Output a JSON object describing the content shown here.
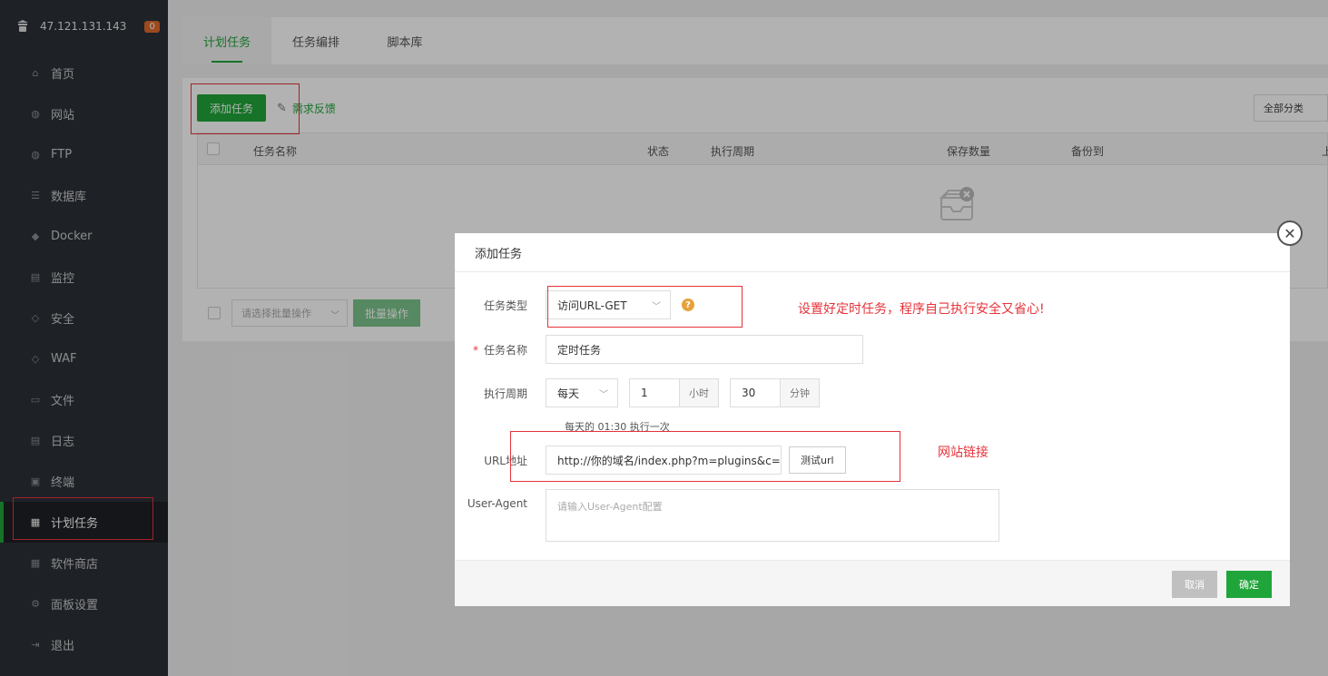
{
  "sidebar": {
    "server_ip": "47.121.131.143",
    "badge": "0",
    "items": [
      {
        "label": "首页",
        "icon": "home-icon",
        "glyph": "⌂"
      },
      {
        "label": "网站",
        "icon": "globe-icon",
        "glyph": "◍"
      },
      {
        "label": "FTP",
        "icon": "ftp-icon",
        "glyph": "◍"
      },
      {
        "label": "数据库",
        "icon": "database-icon",
        "glyph": "☰"
      },
      {
        "label": "Docker",
        "icon": "docker-icon",
        "glyph": "◆"
      },
      {
        "label": "监控",
        "icon": "monitor-icon",
        "glyph": "▤"
      },
      {
        "label": "安全",
        "icon": "shield-icon",
        "glyph": "◇"
      },
      {
        "label": "WAF",
        "icon": "waf-icon",
        "glyph": "◇"
      },
      {
        "label": "文件",
        "icon": "folder-icon",
        "glyph": "▭"
      },
      {
        "label": "日志",
        "icon": "log-icon",
        "glyph": "▤"
      },
      {
        "label": "终端",
        "icon": "terminal-icon",
        "glyph": "▣"
      },
      {
        "label": "计划任务",
        "icon": "calendar-icon",
        "glyph": "▦"
      },
      {
        "label": "软件商店",
        "icon": "apps-icon",
        "glyph": "▦"
      },
      {
        "label": "面板设置",
        "icon": "gear-icon",
        "glyph": "⚙"
      },
      {
        "label": "退出",
        "icon": "logout-icon",
        "glyph": "⇥"
      }
    ]
  },
  "tabs": [
    "计划任务",
    "任务编排",
    "脚本库"
  ],
  "toolbar": {
    "add_label": "添加任务",
    "feedback_label": "需求反馈",
    "category_select": "全部分类"
  },
  "table": {
    "columns": [
      "任务名称",
      "状态",
      "执行周期",
      "保存数量",
      "备份到",
      "上"
    ]
  },
  "batch": {
    "select_placeholder": "请选择批量操作",
    "button": "批量操作"
  },
  "modal": {
    "title": "添加任务",
    "task_type_label": "任务类型",
    "task_type_value": "访问URL-GET",
    "task_name_label": "任务名称",
    "task_name_value": "定时任务",
    "cycle_label": "执行周期",
    "cycle_value": "每天",
    "hour_value": "1",
    "hour_unit": "小时",
    "minute_value": "30",
    "minute_unit": "分钟",
    "cycle_hint": "每天的 01:30 执行一次",
    "url_label": "URL地址",
    "url_value": "http://你的域名/index.php?m=plugins&c=Au",
    "test_button": "测试url",
    "ua_label": "User-Agent",
    "ua_placeholder": "请输入User-Agent配置",
    "cancel": "取消",
    "confirm": "确定"
  },
  "annotations": {
    "task_note": "设置好定时任务，程序自己执行安全又省心!",
    "url_note": "网站链接"
  },
  "colors": {
    "accent": "#20a53a",
    "sidebar_bg": "#2c3138",
    "annotation": "#e6333a"
  }
}
